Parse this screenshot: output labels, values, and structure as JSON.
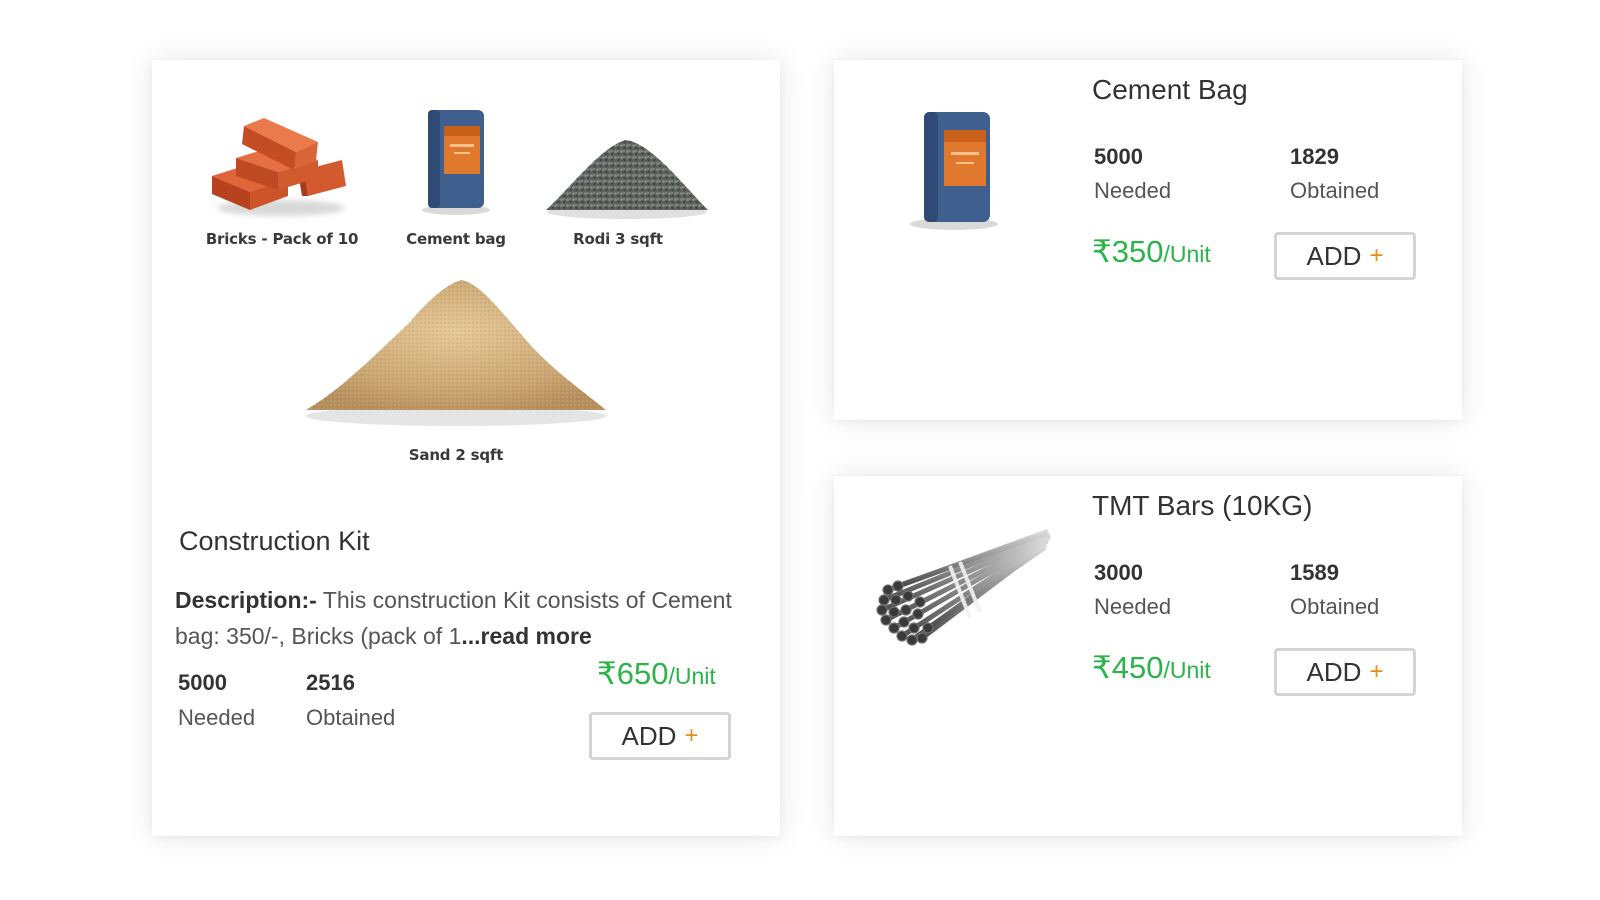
{
  "kit": {
    "items": [
      {
        "caption": "Bricks - Pack of 10",
        "icon": "bricks-icon"
      },
      {
        "caption": "Cement bag",
        "icon": "cement-bag-icon"
      },
      {
        "caption": "Rodi 3 sqft",
        "icon": "gravel-pile-icon"
      },
      {
        "caption": "Sand 2 sqft",
        "icon": "sand-pile-icon"
      }
    ],
    "title": "Construction Kit",
    "description_label": "Description:-",
    "description_text": " This construction Kit consists of Cement bag: 350/-, Bricks (pack of 1",
    "read_more": "...read more",
    "needed_value": "5000",
    "needed_label": "Needed",
    "obtained_value": "2516",
    "obtained_label": "Obtained",
    "price": "₹650",
    "unit": "/Unit",
    "add_label": "ADD",
    "add_icon": "+"
  },
  "cement": {
    "title": "Cement Bag",
    "needed_value": "5000",
    "needed_label": "Needed",
    "obtained_value": "1829",
    "obtained_label": "Obtained",
    "price": "₹350",
    "unit": "/Unit",
    "add_label": "ADD",
    "add_icon": "+"
  },
  "tmt": {
    "title": "TMT Bars (10KG)",
    "needed_value": "3000",
    "needed_label": "Needed",
    "obtained_value": "1589",
    "obtained_label": "Obtained",
    "price": "₹450",
    "unit": "/Unit",
    "add_label": "ADD",
    "add_icon": "+"
  },
  "colors": {
    "price_green": "#2cb44a",
    "plus_orange": "#f08a18",
    "button_border": "#d4d4d4"
  }
}
